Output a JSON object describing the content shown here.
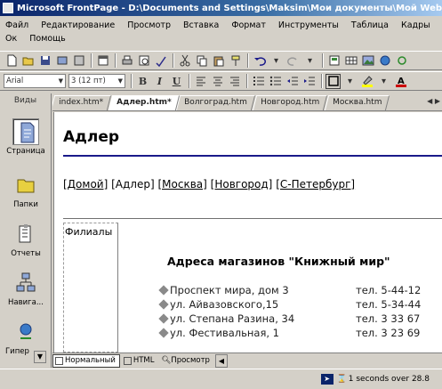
{
  "window": {
    "title": "Microsoft FrontPage - D:\\Documents and Settings\\Maksim\\Мои документы\\Мой Web\\"
  },
  "menu": {
    "items": [
      "Файл",
      "Редактирование",
      "Просмотр",
      "Вставка",
      "Формат",
      "Инструменты",
      "Таблица",
      "Кадры",
      "Ок",
      "Помощь"
    ]
  },
  "toolbar_format": {
    "style": "Arial",
    "size": "3 (12 пт)",
    "bold": "B",
    "italic": "I",
    "underline": "U"
  },
  "views": {
    "header": "Виды",
    "items": [
      {
        "label": "Страница",
        "icon": "page-view-icon",
        "active": true
      },
      {
        "label": "Папки",
        "icon": "folders-view-icon",
        "active": false
      },
      {
        "label": "Отчеты",
        "icon": "reports-view-icon",
        "active": false
      },
      {
        "label": "Навига...",
        "icon": "navigation-view-icon",
        "active": false
      },
      {
        "label": "Гипер",
        "icon": "hyperlinks-view-icon",
        "active": false
      }
    ]
  },
  "tabs": [
    {
      "label": "index.htm*",
      "active": false
    },
    {
      "label": "Адлер.htm*",
      "active": true
    },
    {
      "label": "Волгоград.htm",
      "active": false
    },
    {
      "label": "Новгород.htm",
      "active": false
    },
    {
      "label": "Москва.htm",
      "active": false
    }
  ],
  "page": {
    "title": "Адлер",
    "nav": [
      {
        "text": "[Домой]",
        "link": true
      },
      {
        "text": "[Адлер]",
        "link": false
      },
      {
        "text": "[Москва]",
        "link": true
      },
      {
        "text": "[Новгород]",
        "link": true
      },
      {
        "text": "[С-Петербург]",
        "link": true
      }
    ],
    "left_cell": "Филиалы",
    "shops_title": "Адреса магазинов \"Книжный мир\"",
    "shops": [
      {
        "addr": "Проспект мира, дом 3",
        "tel": "тел. 5-44-12"
      },
      {
        "addr": "ул. Айвазовского,15",
        "tel": "тел. 5-34-44"
      },
      {
        "addr": "ул. Степана Разина, 34",
        "tel": "тел. 3 33 67"
      },
      {
        "addr": "ул. Фестивальная, 1",
        "tel": "тел. 3 23 69"
      }
    ]
  },
  "view_tabs": [
    {
      "label": "Нормальный",
      "active": true
    },
    {
      "label": "HTML",
      "active": false
    },
    {
      "label": "Просмотр",
      "active": false
    }
  ],
  "status": {
    "text": "1 seconds over 28.8"
  }
}
